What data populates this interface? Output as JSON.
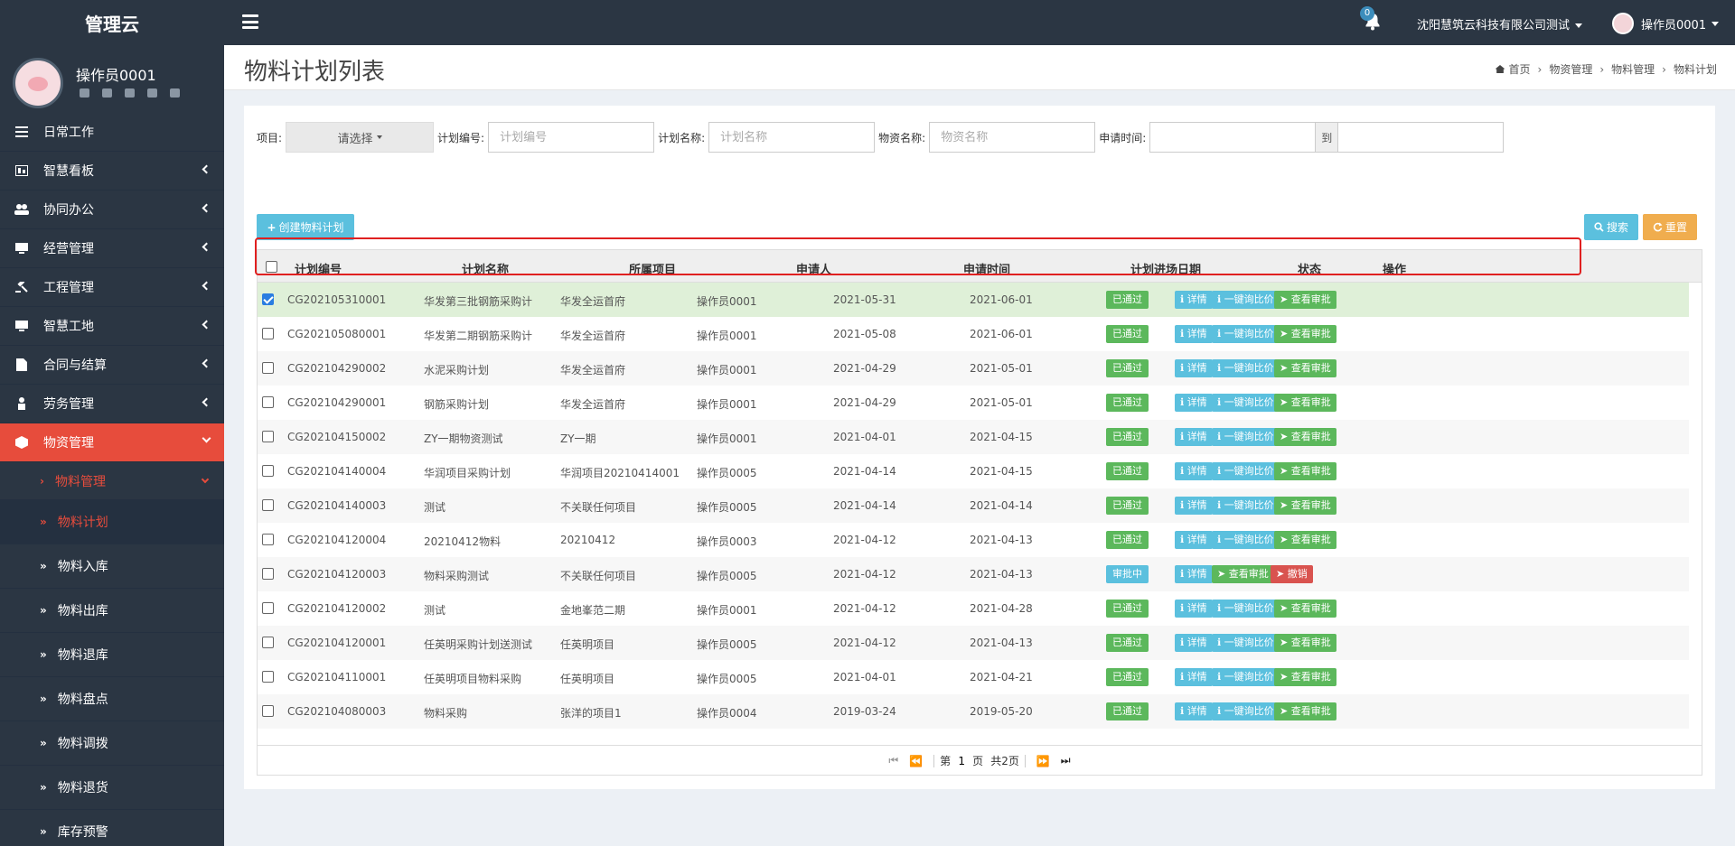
{
  "app": {
    "brand": "管理云"
  },
  "topbar": {
    "notification_count": "0",
    "company": "沈阳慧筑云科技有限公司测试",
    "user": "操作员0001"
  },
  "sidebar": {
    "user_name": "操作员0001",
    "menu": [
      {
        "label": "日常工作",
        "icon": "list-icon"
      },
      {
        "label": "智慧看板",
        "icon": "dashboard-icon"
      },
      {
        "label": "协同办公",
        "icon": "users-icon"
      },
      {
        "label": "经营管理",
        "icon": "monitor-icon"
      },
      {
        "label": "工程管理",
        "icon": "gavel-icon"
      },
      {
        "label": "智慧工地",
        "icon": "monitor-icon"
      },
      {
        "label": "合同与结算",
        "icon": "file-icon"
      },
      {
        "label": "劳务管理",
        "icon": "worker-icon"
      },
      {
        "label": "物资管理",
        "icon": "cube-icon"
      }
    ],
    "submenu_parent": "物料管理",
    "submenu": [
      "物料计划",
      "物料入库",
      "物料出库",
      "物料退库",
      "物料盘点",
      "物料调拨",
      "物料退货",
      "库存预警"
    ]
  },
  "page": {
    "title": "物料计划列表",
    "breadcrumb": [
      "首页",
      "物资管理",
      "物料管理",
      "物料计划"
    ]
  },
  "filters": {
    "project_label": "项目:",
    "project_value": "请选择",
    "plan_no_label": "计划编号:",
    "plan_no_placeholder": "计划编号",
    "plan_name_label": "计划名称:",
    "plan_name_placeholder": "计划名称",
    "material_label": "物资名称:",
    "material_placeholder": "物资名称",
    "apply_time_label": "申请时间:",
    "to_label": "到"
  },
  "buttons": {
    "create": "创建物料计划",
    "search": "搜索",
    "reset": "重置"
  },
  "table": {
    "headers": [
      "计划编号",
      "计划名称",
      "所属项目",
      "申请人",
      "申请时间",
      "计划进场日期",
      "状态",
      "操作"
    ],
    "rows": [
      {
        "no": "CG202105310001",
        "name": "华发第三批钢筋采购计",
        "project": "华发全运首府",
        "applicant": "操作员0001",
        "apply": "2021-05-31",
        "entry": "2021-06-01",
        "status": "已通过",
        "ops": [
          "详情",
          "一键询比价",
          "查看审批"
        ]
      },
      {
        "no": "CG202105080001",
        "name": "华发第二期钢筋采购计",
        "project": "华发全运首府",
        "applicant": "操作员0001",
        "apply": "2021-05-08",
        "entry": "2021-06-01",
        "status": "已通过",
        "ops": [
          "详情",
          "一键询比价",
          "查看审批"
        ]
      },
      {
        "no": "CG202104290002",
        "name": "水泥采购计划",
        "project": "华发全运首府",
        "applicant": "操作员0001",
        "apply": "2021-04-29",
        "entry": "2021-05-01",
        "status": "已通过",
        "ops": [
          "详情",
          "一键询比价",
          "查看审批"
        ]
      },
      {
        "no": "CG202104290001",
        "name": "钢筋采购计划",
        "project": "华发全运首府",
        "applicant": "操作员0001",
        "apply": "2021-04-29",
        "entry": "2021-05-01",
        "status": "已通过",
        "ops": [
          "详情",
          "一键询比价",
          "查看审批"
        ]
      },
      {
        "no": "CG202104150002",
        "name": "ZY一期物资测试",
        "project": "ZY一期",
        "applicant": "操作员0001",
        "apply": "2021-04-01",
        "entry": "2021-04-15",
        "status": "已通过",
        "ops": [
          "详情",
          "一键询比价",
          "查看审批"
        ]
      },
      {
        "no": "CG202104140004",
        "name": "华润项目采购计划",
        "project": "华润项目20210414001",
        "applicant": "操作员0005",
        "apply": "2021-04-14",
        "entry": "2021-04-15",
        "status": "已通过",
        "ops": [
          "详情",
          "一键询比价",
          "查看审批"
        ]
      },
      {
        "no": "CG202104140003",
        "name": "测试",
        "project": "不关联任何项目",
        "applicant": "操作员0005",
        "apply": "2021-04-14",
        "entry": "2021-04-14",
        "status": "已通过",
        "ops": [
          "详情",
          "一键询比价",
          "查看审批"
        ]
      },
      {
        "no": "CG202104120004",
        "name": "20210412物料",
        "project": "20210412",
        "applicant": "操作员0003",
        "apply": "2021-04-12",
        "entry": "2021-04-13",
        "status": "已通过",
        "ops": [
          "详情",
          "一键询比价",
          "查看审批"
        ]
      },
      {
        "no": "CG202104120003",
        "name": "物料采购测试",
        "project": "不关联任何项目",
        "applicant": "操作员0005",
        "apply": "2021-04-12",
        "entry": "2021-04-13",
        "status": "审批中",
        "ops": [
          "详情",
          "查看审批",
          "撤销"
        ]
      },
      {
        "no": "CG202104120002",
        "name": "测试",
        "project": "金地峯范二期",
        "applicant": "操作员0001",
        "apply": "2021-04-12",
        "entry": "2021-04-28",
        "status": "已通过",
        "ops": [
          "详情",
          "一键询比价",
          "查看审批"
        ]
      },
      {
        "no": "CG202104120001",
        "name": "任英明采购计划送测试",
        "project": "任英明项目",
        "applicant": "操作员0005",
        "apply": "2021-04-12",
        "entry": "2021-04-13",
        "status": "已通过",
        "ops": [
          "详情",
          "一键询比价",
          "查看审批"
        ]
      },
      {
        "no": "CG202104110001",
        "name": "任英明项目物料采购",
        "project": "任英明项目",
        "applicant": "操作员0005",
        "apply": "2021-04-01",
        "entry": "2021-04-21",
        "status": "已通过",
        "ops": [
          "详情",
          "一键询比价",
          "查看审批"
        ]
      },
      {
        "no": "CG202104080003",
        "name": "物料采购",
        "project": "张洋的项目1",
        "applicant": "操作员0004",
        "apply": "2019-03-24",
        "entry": "2019-05-20",
        "status": "已通过",
        "ops": [
          "详情",
          "一键询比价",
          "查看审批"
        ]
      }
    ]
  },
  "pager": {
    "page_prefix": "第",
    "page_value": "1",
    "page_suffix": "页",
    "total": "共2页"
  },
  "colors": {
    "sidebar": "#2b3643",
    "active": "#e74c3c",
    "success": "#5cb85c",
    "info": "#5bc0de",
    "warning": "#f0ad4e",
    "danger": "#d9534f"
  }
}
